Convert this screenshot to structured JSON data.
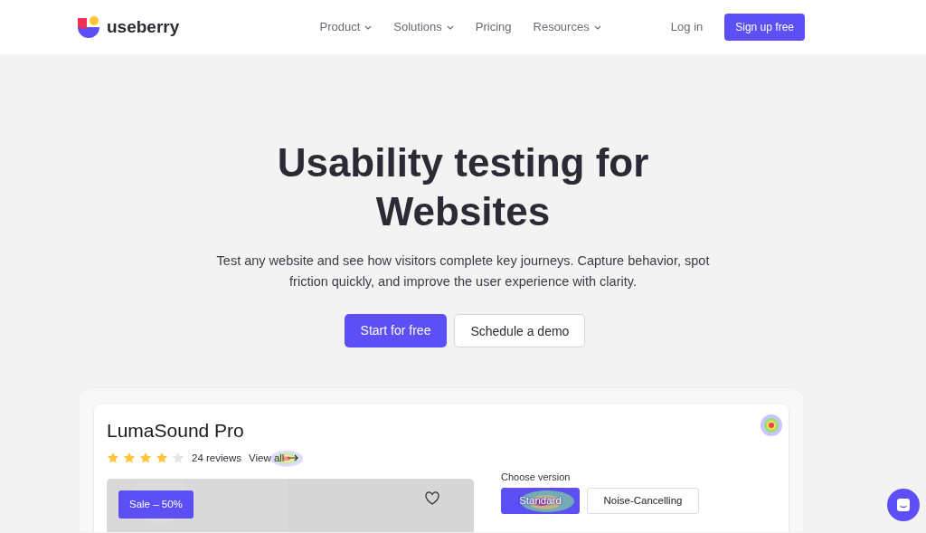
{
  "brand": {
    "name": "useberry"
  },
  "nav": [
    {
      "label": "Product",
      "dropdown": true
    },
    {
      "label": "Solutions",
      "dropdown": true
    },
    {
      "label": "Pricing",
      "dropdown": false
    },
    {
      "label": "Resources",
      "dropdown": true
    }
  ],
  "login": "Log in",
  "signup": "Sign up free",
  "hero": {
    "title": "Usability testing for Websites",
    "subtitle": "Test any website and see how visitors complete key journeys. Capture behavior, spot friction quickly, and improve the user experience with clarity.",
    "primary": "Start for free",
    "secondary": "Schedule a demo"
  },
  "product": {
    "name": "LumaSound Pro",
    "stars": 4,
    "reviews": "24 reviews",
    "view_all": "View all",
    "badge": "Sale – 50%",
    "version_label": "Choose version",
    "versions": [
      {
        "label": "Standard",
        "selected": true
      },
      {
        "label": "Noise-Cancelling",
        "selected": false
      }
    ]
  }
}
